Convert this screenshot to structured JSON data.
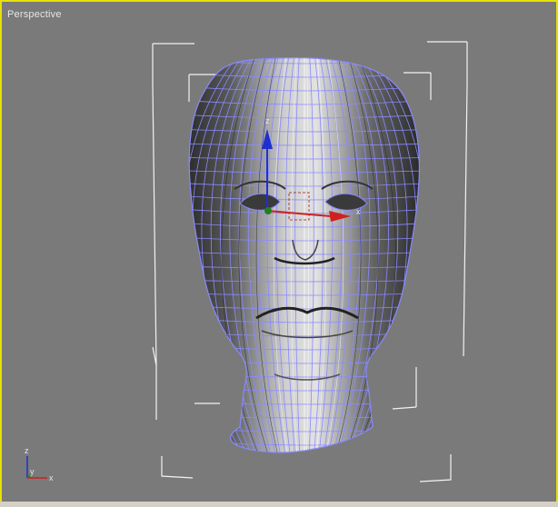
{
  "viewport": {
    "label": "Perspective",
    "border_color": "#e8e000",
    "background": "#7a7a7a"
  },
  "gizmo": {
    "x_label": "x",
    "y_label": "y",
    "z_label": "z",
    "x_color": "#d02020",
    "y_color": "#208020",
    "z_color": "#2030d0"
  },
  "transform_gizmo": {
    "z_label": "z",
    "x_label": "x"
  },
  "mesh": {
    "wire_color": "#8a8aff",
    "surface_color": "#d8d8d8",
    "shade_color": "#3a3a3a"
  }
}
